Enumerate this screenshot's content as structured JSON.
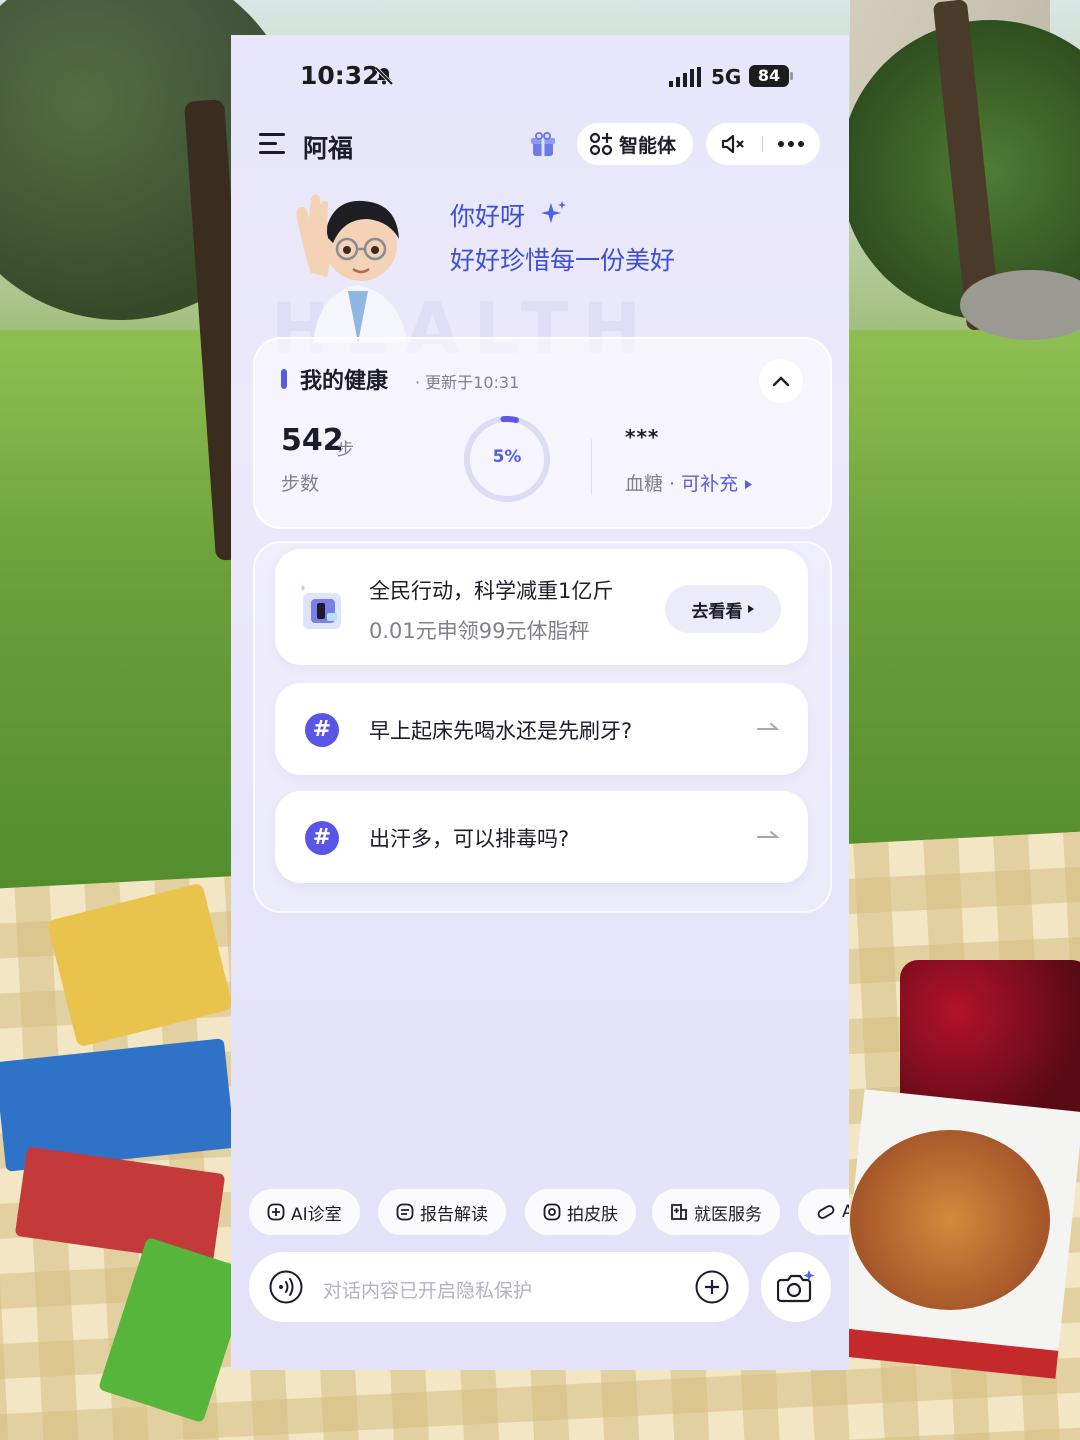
{
  "status": {
    "time": "10:32",
    "network": "5G",
    "battery": "84"
  },
  "topbar": {
    "title": "阿福",
    "agent_label": "智能体"
  },
  "hero": {
    "greeting": "你好呀",
    "tagline": "好好珍惜每一份美好",
    "watermark": "HEALTH"
  },
  "health": {
    "title": "我的健康",
    "updated": "· 更新于10:31",
    "steps_value": "542",
    "steps_unit": "步",
    "steps_label": "步数",
    "progress_text": "5%",
    "progress_fraction": 0.05,
    "blood_sugar_value": "***",
    "blood_sugar_label": "血糖 · ",
    "blood_sugar_action": "可补充"
  },
  "promo": {
    "title": "全民行动，科学减重1亿斤",
    "subtitle": "0.01元申领99元体脂秤",
    "button": "去看看"
  },
  "questions": [
    {
      "text": "早上起床先喝水还是先刷牙?"
    },
    {
      "text": "出汗多，可以排毒吗?"
    }
  ],
  "quick_actions": [
    {
      "label": "AI诊室",
      "icon": "plus-square-icon"
    },
    {
      "label": "报告解读",
      "icon": "document-icon"
    },
    {
      "label": "拍皮肤",
      "icon": "camera-icon"
    },
    {
      "label": "就医服务",
      "icon": "hospital-icon"
    },
    {
      "label": "A",
      "icon": "pill-icon"
    }
  ],
  "input": {
    "placeholder": "对话内容已开启隐私保护"
  },
  "colors": {
    "accent": "#5a5ce0",
    "greeting": "#3d4fd6",
    "hash_badge": "#5b55e6"
  }
}
